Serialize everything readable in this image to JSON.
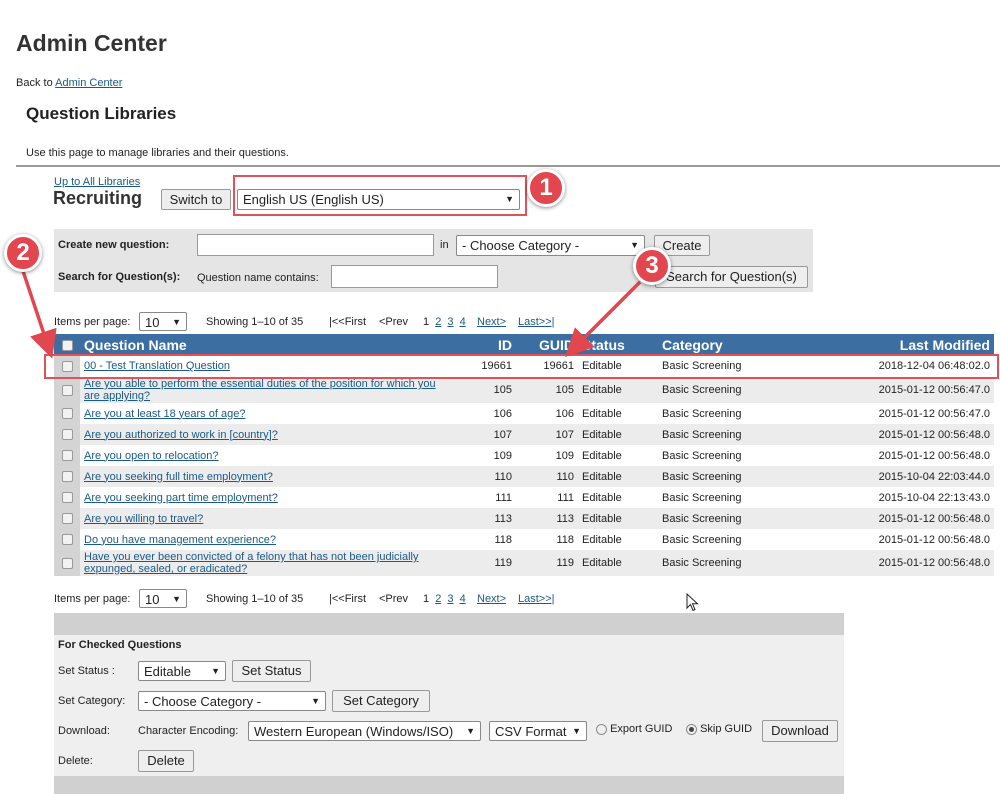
{
  "header": {
    "title": "Admin Center",
    "back_prefix": "Back to",
    "back_link": "Admin Center",
    "section_title": "Question Libraries",
    "intro": "Use this page to manage libraries and their questions."
  },
  "library": {
    "up_link": "Up to All Libraries",
    "name": "Recruiting",
    "switch_label": "Switch to",
    "language": "English US (English US)"
  },
  "search": {
    "create_label": "Create new question:",
    "create_value": "",
    "in_label": "in",
    "category_select": "- Choose Category -",
    "create_button": "Create",
    "search_label": "Search for Question(s):",
    "name_contains_label": "Question name contains:",
    "name_contains_value": "",
    "search_button": "Search for Question(s)"
  },
  "pager": {
    "items_label": "Items per page:",
    "items_value": "10",
    "showing": "Showing 1–10 of 35",
    "first": "|<<First",
    "prev": "<Prev",
    "pages": [
      "1",
      "2",
      "3",
      "4"
    ],
    "next": "Next>",
    "last": "Last>>|"
  },
  "table": {
    "headers": {
      "name": "Question Name",
      "id": "ID",
      "guid": "GUID",
      "status": "Status",
      "category": "Category",
      "modified": "Last Modified"
    },
    "rows": [
      {
        "name": "00 - Test Translation Question",
        "id": "19661",
        "guid": "19661",
        "status": "Editable",
        "category": "Basic Screening",
        "modified": "2018-12-04 06:48:02.0"
      },
      {
        "name": "Are you able to perform the essential duties of the position for which you are applying?",
        "id": "105",
        "guid": "105",
        "status": "Editable",
        "category": "Basic Screening",
        "modified": "2015-01-12 00:56:47.0"
      },
      {
        "name": "Are you at least 18 years of age?",
        "id": "106",
        "guid": "106",
        "status": "Editable",
        "category": "Basic Screening",
        "modified": "2015-01-12 00:56:47.0"
      },
      {
        "name": "Are you authorized to work in [country]?",
        "id": "107",
        "guid": "107",
        "status": "Editable",
        "category": "Basic Screening",
        "modified": "2015-01-12 00:56:48.0"
      },
      {
        "name": "Are you open to relocation?",
        "id": "109",
        "guid": "109",
        "status": "Editable",
        "category": "Basic Screening",
        "modified": "2015-01-12 00:56:48.0"
      },
      {
        "name": "Are you seeking full time employment?",
        "id": "110",
        "guid": "110",
        "status": "Editable",
        "category": "Basic Screening",
        "modified": "2015-10-04 22:03:44.0"
      },
      {
        "name": "Are you seeking part time employment?",
        "id": "111",
        "guid": "111",
        "status": "Editable",
        "category": "Basic Screening",
        "modified": "2015-10-04 22:13:43.0"
      },
      {
        "name": "Are you willing to travel?",
        "id": "113",
        "guid": "113",
        "status": "Editable",
        "category": "Basic Screening",
        "modified": "2015-01-12 00:56:48.0"
      },
      {
        "name": "Do you have management experience?",
        "id": "118",
        "guid": "118",
        "status": "Editable",
        "category": "Basic Screening",
        "modified": "2015-01-12 00:56:48.0"
      },
      {
        "name": "Have you ever been convicted of a felony that has not been judicially expunged, sealed, or eradicated?",
        "id": "119",
        "guid": "119",
        "status": "Editable",
        "category": "Basic Screening",
        "modified": "2015-01-12 00:56:48.0"
      }
    ]
  },
  "actions": {
    "title": "For Checked Questions",
    "set_status_label": "Set Status :",
    "status_value": "Editable",
    "set_status_button": "Set Status",
    "set_category_label": "Set Category:",
    "category_value": "- Choose Category -",
    "set_category_button": "Set Category",
    "download_label": "Download:",
    "encoding_label": "Character Encoding:",
    "encoding_value": "Western European (Windows/ISO)",
    "format_value": "CSV Format",
    "export_guid": "Export GUID",
    "skip_guid": "Skip GUID",
    "download_button": "Download",
    "delete_label": "Delete:",
    "delete_button": "Delete"
  },
  "callouts": [
    "1",
    "2",
    "3"
  ],
  "colors": {
    "header_blue": "#3d6ea2",
    "highlight_red": "#e0525a",
    "callout_red": "#e2474f",
    "link": "#1b5a86"
  }
}
